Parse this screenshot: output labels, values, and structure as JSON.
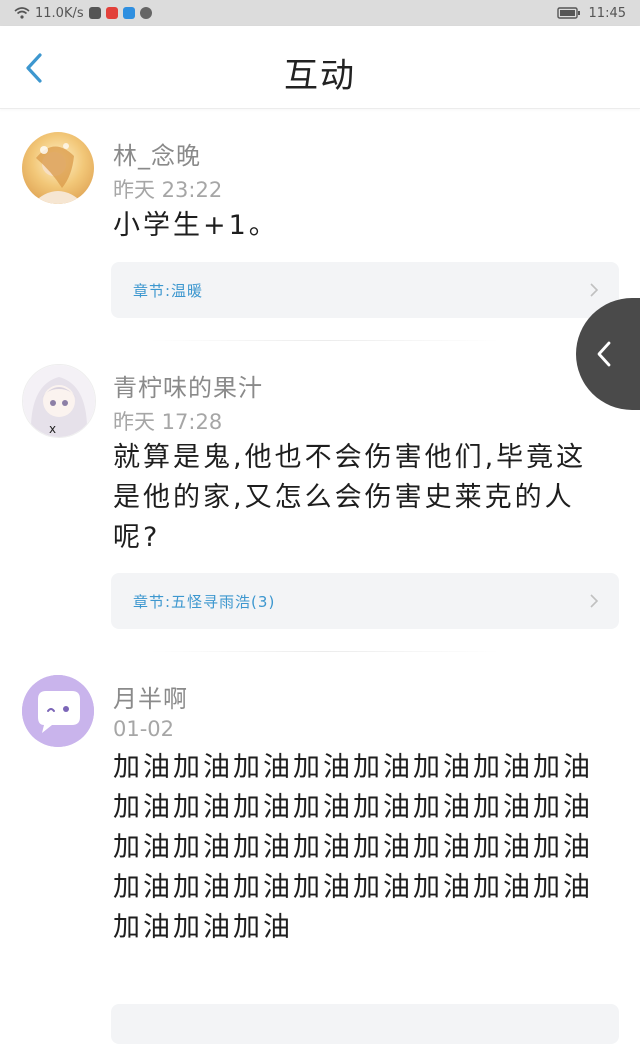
{
  "status_bar": {
    "speed": "11.0K/s",
    "time": "11:45",
    "icons": [
      "wifi-icon",
      "app-icon",
      "app-icon",
      "app-icon",
      "app-icon",
      "battery-icon"
    ]
  },
  "header": {
    "title": "互动",
    "back_icon": "chevron-left-icon"
  },
  "posts": [
    {
      "username": "林_念晚",
      "time": "昨天 23:22",
      "comment": "小学生+1。",
      "chapter": "章节:温暖"
    },
    {
      "username": "青柠味的果汁",
      "time": "昨天 17:28",
      "comment": "就算是鬼,他也不会伤害他们,毕竟这是他的家,又怎么会伤害史莱克的人呢?",
      "chapter": "章节:五怪寻雨浩(3)"
    },
    {
      "username": "月半啊",
      "time": "01-02",
      "comment": "加油加油加油加油加油加油加油加油加油加油加油加油加油加油加油加油加油加油加油加油加油加油加油加油加油加油加油加油加油加油加油加油加油加油加油"
    }
  ],
  "side_float": {
    "icon": "chevron-left-icon"
  },
  "colors": {
    "accent": "#3d97cf",
    "chapter_bg": "#f3f4f6",
    "avatar_purple": "#c9b4ec",
    "float_bg": "#4a4a4a"
  }
}
